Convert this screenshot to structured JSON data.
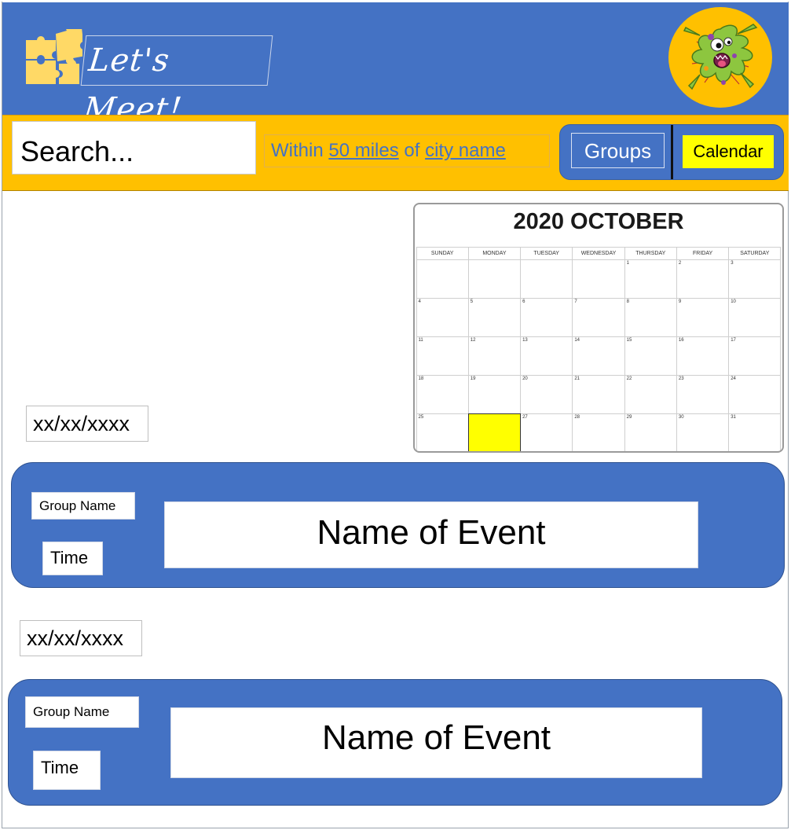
{
  "header": {
    "brand": "Let's Meet!",
    "logo_icon": "puzzle-pieces-icon",
    "mascot_icon": "germ-monster-avatar",
    "colors": {
      "header_bg": "#4472c4",
      "accent": "#ffc000",
      "logo": "#ffd966"
    }
  },
  "searchbar": {
    "placeholder": "Search...",
    "location": {
      "prefix": "Within ",
      "distance": "50 miles",
      "middle": " of ",
      "city": "city name"
    },
    "nav": {
      "groups_label": "Groups",
      "calendar_label": "Calendar"
    },
    "colors": {
      "bar_bg": "#ffc000",
      "calendar_active": "#ffff00"
    }
  },
  "calendar": {
    "title": "2020 OCTOBER",
    "weekdays": [
      "SUNDAY",
      "MONDAY",
      "TUESDAY",
      "WEDNESDAY",
      "THURSDAY",
      "FRIDAY",
      "SATURDAY"
    ],
    "weeks": [
      [
        "",
        "",
        "",
        "",
        "1",
        "2",
        "3"
      ],
      [
        "4",
        "5",
        "6",
        "7",
        "8",
        "9",
        "10"
      ],
      [
        "11",
        "12",
        "13",
        "14",
        "15",
        "16",
        "17"
      ],
      [
        "18",
        "19",
        "20",
        "21",
        "22",
        "23",
        "24"
      ],
      [
        "25",
        "",
        "27",
        "28",
        "29",
        "30",
        "31"
      ]
    ],
    "highlighted_cell": {
      "week": 4,
      "day": 1
    },
    "highlight_color": "#ffff00"
  },
  "events": [
    {
      "date": "xx/xx/xxxx",
      "group_name": "Group Name",
      "time": "Time",
      "event_name": "Name of Event"
    },
    {
      "date": "xx/xx/xxxx",
      "group_name": "Group Name",
      "time": "Time",
      "event_name": "Name of Event"
    }
  ]
}
